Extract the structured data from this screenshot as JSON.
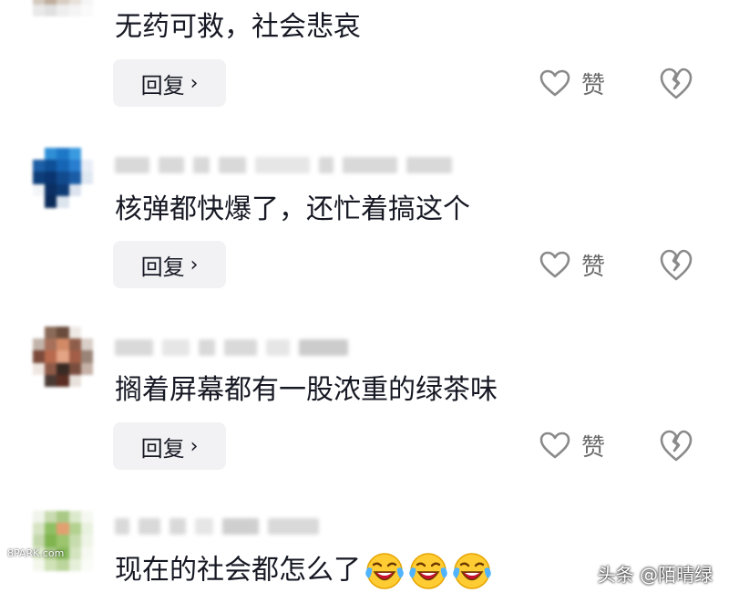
{
  "comments": [
    {
      "text": "无药可救，社会悲哀",
      "reply_label": "回复",
      "like_label": "赞"
    },
    {
      "text": "核弹都快爆了，还忙着搞这个",
      "reply_label": "回复",
      "like_label": "赞"
    },
    {
      "text": "搁着屏幕都有一股浓重的绿茶味",
      "reply_label": "回复",
      "like_label": "赞"
    },
    {
      "text": "现在的社会都怎么了",
      "emoji_count": 3,
      "emoji": "laughing-crying-emoji"
    }
  ],
  "watermark": "头条 @陌晴绿",
  "site_mark": "8PARK.com",
  "colors": {
    "text": "#161823",
    "icon_gray": "#8a8a8a",
    "button_bg": "#f2f2f4"
  }
}
